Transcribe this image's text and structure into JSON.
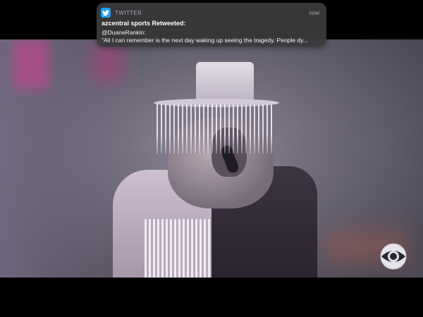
{
  "notification": {
    "app_name": "TWITTER",
    "time": "now",
    "title": "azcentral sports Retweeted:",
    "handle": "@DuaneRankin:",
    "body": "\"All I can remember is the next day waking up seeing the tragedy. People dy...",
    "app_icon": "twitter-bird-icon",
    "accent_color": "#1da1f2"
  },
  "video": {
    "network_logo": "cbs-eye-logo"
  }
}
